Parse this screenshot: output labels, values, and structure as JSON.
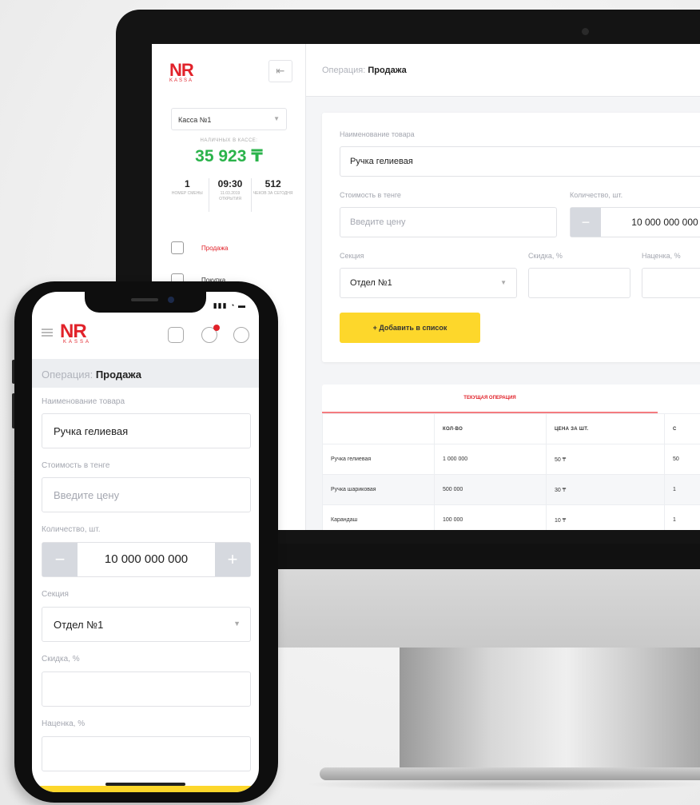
{
  "brand": {
    "logo": "NR",
    "logo_sub": "KASSA",
    "accent": "#e1222a",
    "cash_color": "#2bb34b",
    "button_color": "#fdd72b"
  },
  "desktop": {
    "breadcrumb": {
      "label": "Операция:",
      "value": "Продажа"
    },
    "kassa_select": "Касса №1",
    "cash_label": "НАЛИЧНЫХ В КАССЕ:",
    "cash_value": "35 923 ₸",
    "stats": [
      {
        "value": "1",
        "label": "НОМЕР СМЕНЫ"
      },
      {
        "value": "09:30",
        "label": "11.03.2019 ОТКРЫТИЯ"
      },
      {
        "value": "512",
        "label": "ЧЕКОВ ЗА СЕГОДНЯ"
      }
    ],
    "nav": [
      {
        "label": "Продажа",
        "icon": "printer-icon"
      },
      {
        "label": "Покупка",
        "icon": "cart-icon"
      }
    ],
    "form": {
      "name_label": "Наименование товара",
      "name_value": "Ручка гелиевая",
      "price_label": "Стоимость в тенге",
      "price_placeholder": "Введите цену",
      "qty_label": "Количество, шт.",
      "qty_value": "10 000 000 000",
      "section_label": "Секция",
      "section_value": "Отдел №1",
      "discount_label": "Скидка, %",
      "markup_label": "Наценка, %",
      "add_button": "+ Добавить в список"
    },
    "table": {
      "tab": "ТЕКУЩАЯ ОПЕРАЦИЯ",
      "columns": [
        "",
        "КОЛ-ВО",
        "ЦЕНА ЗА ШТ.",
        "С"
      ],
      "rows": [
        [
          "Ручка гелиевая",
          "1 000 000",
          "50 ₸",
          "50"
        ],
        [
          "Ручка шариковая",
          "500 000",
          "30 ₸",
          "1"
        ],
        [
          "Карандаш",
          "100 000",
          "10 ₸",
          "1"
        ]
      ]
    }
  },
  "phone": {
    "breadcrumb": {
      "label": "Операция:",
      "value": "Продажа"
    },
    "name_label": "Наименование товара",
    "name_value": "Ручка гелиевая",
    "price_label": "Стоимость в тенге",
    "price_placeholder": "Введите цену",
    "qty_label": "Количество, шт.",
    "qty_value": "10 000 000 000",
    "section_label": "Секция",
    "section_value": "Отдел №1",
    "discount_label": "Скидка, %",
    "markup_label": "Наценка, %"
  }
}
